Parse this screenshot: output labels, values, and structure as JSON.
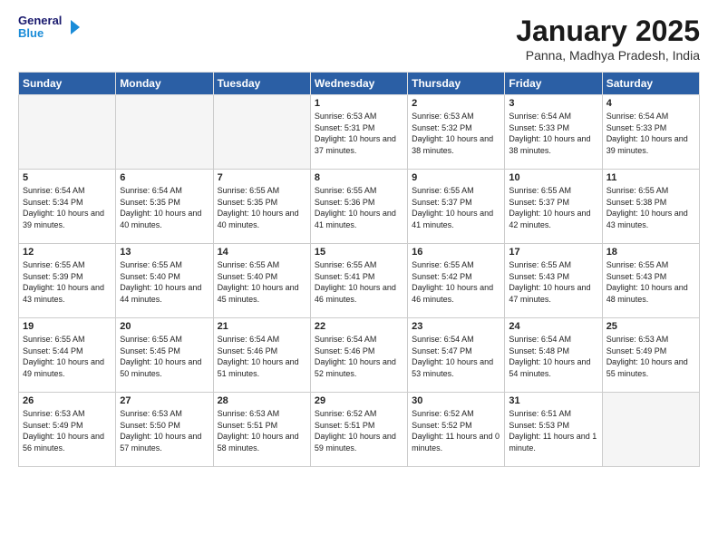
{
  "logo": {
    "line1": "General",
    "line2": "Blue"
  },
  "title": "January 2025",
  "subtitle": "Panna, Madhya Pradesh, India",
  "weekdays": [
    "Sunday",
    "Monday",
    "Tuesday",
    "Wednesday",
    "Thursday",
    "Friday",
    "Saturday"
  ],
  "weeks": [
    [
      {
        "day": "",
        "empty": true
      },
      {
        "day": "",
        "empty": true
      },
      {
        "day": "",
        "empty": true
      },
      {
        "day": "1",
        "sunrise": "6:53 AM",
        "sunset": "5:31 PM",
        "daylight": "10 hours and 37 minutes."
      },
      {
        "day": "2",
        "sunrise": "6:53 AM",
        "sunset": "5:32 PM",
        "daylight": "10 hours and 38 minutes."
      },
      {
        "day": "3",
        "sunrise": "6:54 AM",
        "sunset": "5:33 PM",
        "daylight": "10 hours and 38 minutes."
      },
      {
        "day": "4",
        "sunrise": "6:54 AM",
        "sunset": "5:33 PM",
        "daylight": "10 hours and 39 minutes."
      }
    ],
    [
      {
        "day": "5",
        "sunrise": "6:54 AM",
        "sunset": "5:34 PM",
        "daylight": "10 hours and 39 minutes."
      },
      {
        "day": "6",
        "sunrise": "6:54 AM",
        "sunset": "5:35 PM",
        "daylight": "10 hours and 40 minutes."
      },
      {
        "day": "7",
        "sunrise": "6:55 AM",
        "sunset": "5:35 PM",
        "daylight": "10 hours and 40 minutes."
      },
      {
        "day": "8",
        "sunrise": "6:55 AM",
        "sunset": "5:36 PM",
        "daylight": "10 hours and 41 minutes."
      },
      {
        "day": "9",
        "sunrise": "6:55 AM",
        "sunset": "5:37 PM",
        "daylight": "10 hours and 41 minutes."
      },
      {
        "day": "10",
        "sunrise": "6:55 AM",
        "sunset": "5:37 PM",
        "daylight": "10 hours and 42 minutes."
      },
      {
        "day": "11",
        "sunrise": "6:55 AM",
        "sunset": "5:38 PM",
        "daylight": "10 hours and 43 minutes."
      }
    ],
    [
      {
        "day": "12",
        "sunrise": "6:55 AM",
        "sunset": "5:39 PM",
        "daylight": "10 hours and 43 minutes."
      },
      {
        "day": "13",
        "sunrise": "6:55 AM",
        "sunset": "5:40 PM",
        "daylight": "10 hours and 44 minutes."
      },
      {
        "day": "14",
        "sunrise": "6:55 AM",
        "sunset": "5:40 PM",
        "daylight": "10 hours and 45 minutes."
      },
      {
        "day": "15",
        "sunrise": "6:55 AM",
        "sunset": "5:41 PM",
        "daylight": "10 hours and 46 minutes."
      },
      {
        "day": "16",
        "sunrise": "6:55 AM",
        "sunset": "5:42 PM",
        "daylight": "10 hours and 46 minutes."
      },
      {
        "day": "17",
        "sunrise": "6:55 AM",
        "sunset": "5:43 PM",
        "daylight": "10 hours and 47 minutes."
      },
      {
        "day": "18",
        "sunrise": "6:55 AM",
        "sunset": "5:43 PM",
        "daylight": "10 hours and 48 minutes."
      }
    ],
    [
      {
        "day": "19",
        "sunrise": "6:55 AM",
        "sunset": "5:44 PM",
        "daylight": "10 hours and 49 minutes."
      },
      {
        "day": "20",
        "sunrise": "6:55 AM",
        "sunset": "5:45 PM",
        "daylight": "10 hours and 50 minutes."
      },
      {
        "day": "21",
        "sunrise": "6:54 AM",
        "sunset": "5:46 PM",
        "daylight": "10 hours and 51 minutes."
      },
      {
        "day": "22",
        "sunrise": "6:54 AM",
        "sunset": "5:46 PM",
        "daylight": "10 hours and 52 minutes."
      },
      {
        "day": "23",
        "sunrise": "6:54 AM",
        "sunset": "5:47 PM",
        "daylight": "10 hours and 53 minutes."
      },
      {
        "day": "24",
        "sunrise": "6:54 AM",
        "sunset": "5:48 PM",
        "daylight": "10 hours and 54 minutes."
      },
      {
        "day": "25",
        "sunrise": "6:53 AM",
        "sunset": "5:49 PM",
        "daylight": "10 hours and 55 minutes."
      }
    ],
    [
      {
        "day": "26",
        "sunrise": "6:53 AM",
        "sunset": "5:49 PM",
        "daylight": "10 hours and 56 minutes."
      },
      {
        "day": "27",
        "sunrise": "6:53 AM",
        "sunset": "5:50 PM",
        "daylight": "10 hours and 57 minutes."
      },
      {
        "day": "28",
        "sunrise": "6:53 AM",
        "sunset": "5:51 PM",
        "daylight": "10 hours and 58 minutes."
      },
      {
        "day": "29",
        "sunrise": "6:52 AM",
        "sunset": "5:51 PM",
        "daylight": "10 hours and 59 minutes."
      },
      {
        "day": "30",
        "sunrise": "6:52 AM",
        "sunset": "5:52 PM",
        "daylight": "11 hours and 0 minutes."
      },
      {
        "day": "31",
        "sunrise": "6:51 AM",
        "sunset": "5:53 PM",
        "daylight": "11 hours and 1 minute."
      },
      {
        "day": "",
        "empty": true
      }
    ]
  ]
}
